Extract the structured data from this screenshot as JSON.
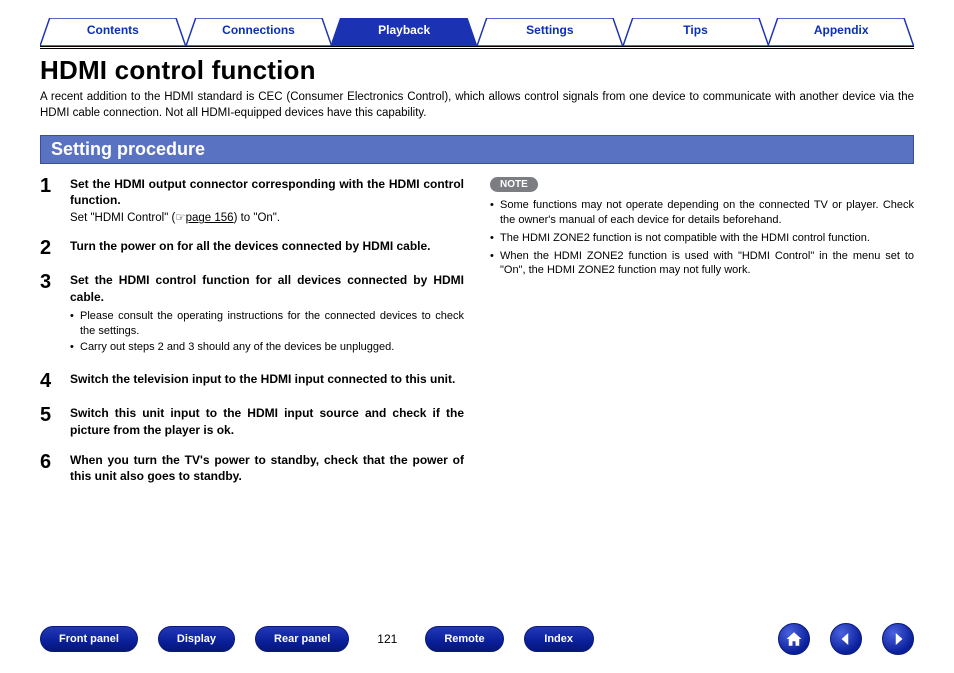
{
  "tabs": [
    {
      "label": "Contents",
      "active": false
    },
    {
      "label": "Connections",
      "active": false
    },
    {
      "label": "Playback",
      "active": true
    },
    {
      "label": "Settings",
      "active": false
    },
    {
      "label": "Tips",
      "active": false
    },
    {
      "label": "Appendix",
      "active": false
    }
  ],
  "title": "HDMI control function",
  "intro": "A recent addition to the HDMI standard is CEC (Consumer Electronics Control), which allows control signals from one device to communicate with another device via the HDMI cable connection. Not all HDMI-equipped devices have this capability.",
  "section_heading": "Setting procedure",
  "steps": [
    {
      "num": "1",
      "heading": "Set the HDMI output connector corresponding with the HDMI control function.",
      "sub_prefix": "Set \"HDMI Control\" (",
      "sub_link": "page 156",
      "sub_suffix": ") to \"On\".",
      "bullets": []
    },
    {
      "num": "2",
      "heading": "Turn the power on for all the devices connected by HDMI cable.",
      "bullets": []
    },
    {
      "num": "3",
      "heading": "Set the HDMI control function for all devices connected by HDMI cable.",
      "bullets": [
        "Please consult the operating instructions for the connected devices to check the settings.",
        "Carry out steps 2 and 3 should any of the devices be unplugged."
      ]
    },
    {
      "num": "4",
      "heading": "Switch the television input to the HDMI input connected to this unit.",
      "bullets": []
    },
    {
      "num": "5",
      "heading": "Switch this unit input to the HDMI input source and check if the picture from the player is ok.",
      "bullets": []
    },
    {
      "num": "6",
      "heading": "When you turn the TV's power to standby, check that the power of this unit also goes to standby.",
      "bullets": []
    }
  ],
  "note_label": "NOTE",
  "notes": [
    "Some functions may not operate depending on the connected TV or player. Check the owner's manual of each device for details beforehand.",
    "The HDMI ZONE2 function is not compatible with the HDMI control function.",
    "When the HDMI ZONE2 function is used with \"HDMI Control\" in the menu set to \"On\", the HDMI ZONE2 function may not fully work."
  ],
  "footer": {
    "buttons_left": [
      "Front panel",
      "Display",
      "Rear panel"
    ],
    "page_number": "121",
    "buttons_right": [
      "Remote",
      "Index"
    ]
  },
  "hand_icon": "☞"
}
